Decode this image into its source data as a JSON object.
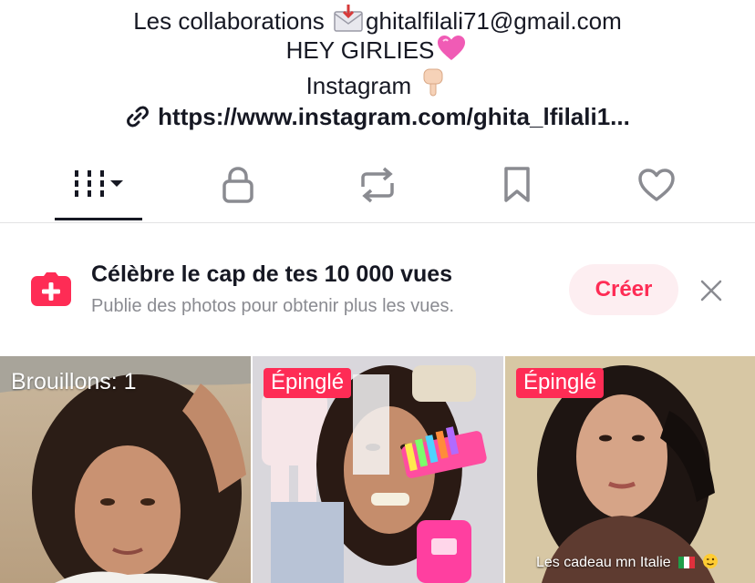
{
  "bio": {
    "line1_text": "Les collaborations ",
    "line1_email": "ghitalfilali71@gmail.com",
    "line2_text": "HEY GIRLIES",
    "line3_text": "Instagram ",
    "link": "https://www.instagram.com/ghita_lfilali1..."
  },
  "tabs": [
    {
      "name": "videos-grid",
      "icon": "grid-bars-icon",
      "active": true
    },
    {
      "name": "private",
      "icon": "lock-icon",
      "active": false
    },
    {
      "name": "reposts",
      "icon": "repost-icon",
      "active": false
    },
    {
      "name": "saved",
      "icon": "bookmark-icon",
      "active": false
    },
    {
      "name": "liked",
      "icon": "heart-icon",
      "active": false
    }
  ],
  "banner": {
    "title": "Célèbre le cap de tes 10 000 vues",
    "subtitle": "Publie des photos pour obtenir plus les vues.",
    "button_label": "Créer"
  },
  "grid": {
    "tile1_label": "Brouillons: 1",
    "tile2_badge": "Épinglé",
    "tile3_badge": "Épinglé",
    "tile3_caption": "Les cadeau mn Italie"
  },
  "colors": {
    "accent": "#fe2c55",
    "accent_soft": "#fdeef1",
    "text": "#161823",
    "muted": "#8a8b91"
  }
}
